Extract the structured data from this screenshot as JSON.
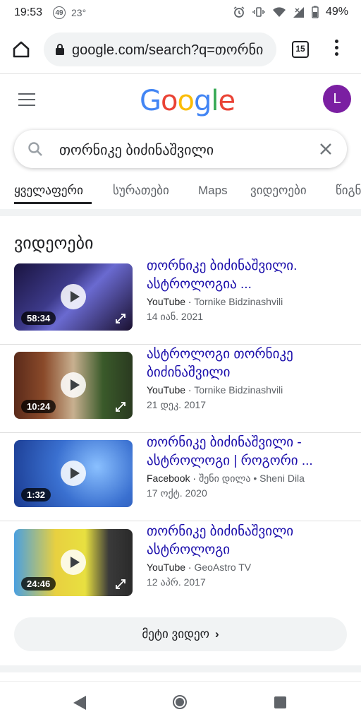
{
  "status": {
    "time": "19:53",
    "notif_count": "49",
    "temperature": "23°",
    "battery": "49%"
  },
  "browser": {
    "url": "google.com/search?q=თორნი",
    "tab_count": "15"
  },
  "header": {
    "logo": "Google",
    "avatar_letter": "L"
  },
  "search": {
    "query": "თორნიკე ბიძინაშვილი"
  },
  "tabs": [
    "ყველაფერი",
    "სურათები",
    "Maps",
    "ვიდეოები",
    "წიგნ"
  ],
  "section_title": "ვიდეოები",
  "videos": [
    {
      "title": "თორნიკე ბიძინაშვილი. ასტროლოგია ...",
      "source": "YouTube",
      "channel": "Tornike Bidzinashvili",
      "date": "14 იან. 2021",
      "duration": "58:34"
    },
    {
      "title": "ასტროლოგი თორნიკე ბიძინაშვილი",
      "source": "YouTube",
      "channel": "Tornike Bidzinashvili",
      "date": "21 დეკ. 2017",
      "duration": "10:24"
    },
    {
      "title": "თორნიკე ბიძინაშვილი - ასტროლოგი | როგორი ...",
      "source": "Facebook",
      "channel": "შენი დილა • Sheni Dila",
      "date": "17 ოქტ. 2020",
      "duration": "1:32"
    },
    {
      "title": "თორნიკე ბიძინაშვილი ასტროლოგი",
      "source": "YouTube",
      "channel": "GeoAstro TV",
      "date": "12 აპრ. 2017",
      "duration": "24:46"
    }
  ],
  "more_videos": "მეტი ვიდეო",
  "colors": {
    "link": "#1a0dab",
    "avatar": "#7b1fa2"
  }
}
